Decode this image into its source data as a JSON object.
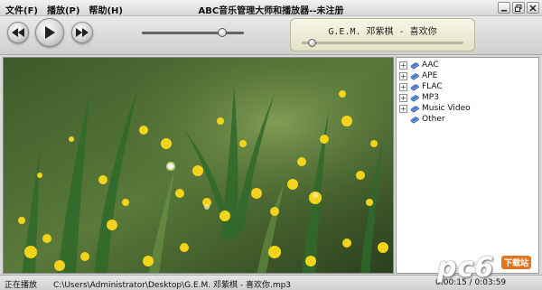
{
  "menu": [
    {
      "label": "文件(F)"
    },
    {
      "label": "播放(P)"
    },
    {
      "label": "帮助(H)"
    }
  ],
  "window": {
    "title": "ABC音乐管理大师和播放器--未注册",
    "buttons": [
      "minimize-icon",
      "restore-icon",
      "close-icon"
    ]
  },
  "controls": {
    "icons": [
      "rewind-icon",
      "play-icon",
      "fast-forward-icon"
    ],
    "volume_level": 0.79
  },
  "now_playing": {
    "track": "G.E.M. 邓紫棋 - 喜欢你",
    "progress": 0.04
  },
  "sidebar": {
    "items": [
      {
        "label": "AAC",
        "expandable": true
      },
      {
        "label": "APE",
        "expandable": true
      },
      {
        "label": "FLAC",
        "expandable": true
      },
      {
        "label": "MP3",
        "expandable": true
      },
      {
        "label": "Music Video",
        "expandable": true
      },
      {
        "label": "Other",
        "expandable": false
      }
    ]
  },
  "status": {
    "state": "正在播放",
    "path": "C:\\Users\\Administrator\\Desktop\\G.E.M. 邓紫棋 - 喜欢你.mp3",
    "time": "0:00:15 / 0:03:59"
  },
  "watermark": {
    "text": "pc6",
    "tag": "下载站"
  },
  "colors": {
    "accent_orange": "#e0761f",
    "lcd_bg": "#f0f0dc",
    "folder_blue": "#4a7fc1"
  }
}
